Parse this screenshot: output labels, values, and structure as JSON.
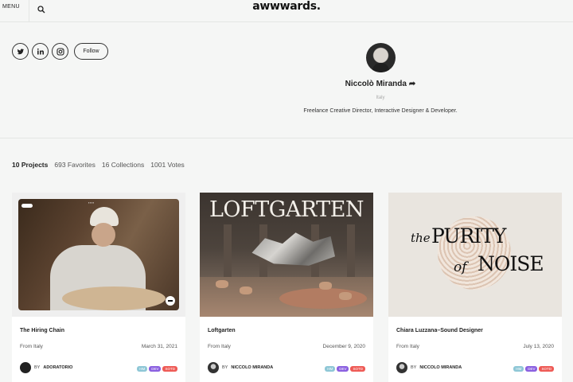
{
  "header": {
    "menu_label": "MENU",
    "logo": "awwwards.",
    "search_icon": "search-icon"
  },
  "social": {
    "icons": [
      "twitter-icon",
      "linkedin-icon",
      "instagram-icon"
    ],
    "follow_label": "Follow"
  },
  "profile": {
    "name": "Niccolò Miranda",
    "country": "Italy",
    "bio": "Freelance Creative Director, Interactive Designer & Developer."
  },
  "stats": {
    "projects": "10 Projects",
    "favorites": "693 Favorites",
    "collections": "16 Collections",
    "votes": "1001 Votes"
  },
  "cards": [
    {
      "title": "The Hiring Chain",
      "from": "From Italy",
      "date": "March 31, 2021",
      "by": "BY",
      "author": "ADORATORIO",
      "tags": [
        "HM",
        "DEV",
        "SOTD"
      ]
    },
    {
      "title": "Loftgarten",
      "thumb_text": "LOFTGARTEN",
      "from": "From Italy",
      "date": "December 9, 2020",
      "by": "BY",
      "author": "NICCOLO MIRANDA",
      "tags": [
        "HM",
        "DEV",
        "SOTD"
      ]
    },
    {
      "title": "Chiara Luzzana–Sound Designer",
      "thumb_text": {
        "the": "the",
        "purity": "PURITY",
        "of": "of",
        "noise": "NOISE"
      },
      "from": "From Italy",
      "date": "July 13, 2020",
      "by": "BY",
      "author": "NICCOLO MIRANDA",
      "tags": [
        "HM",
        "DEV",
        "SOTD"
      ]
    }
  ],
  "colors": {
    "background": "#f5f6f5",
    "tag_hm": "#8ec7d6",
    "tag_dev": "#8a5fe0",
    "tag_sotd": "#ee5a55"
  }
}
